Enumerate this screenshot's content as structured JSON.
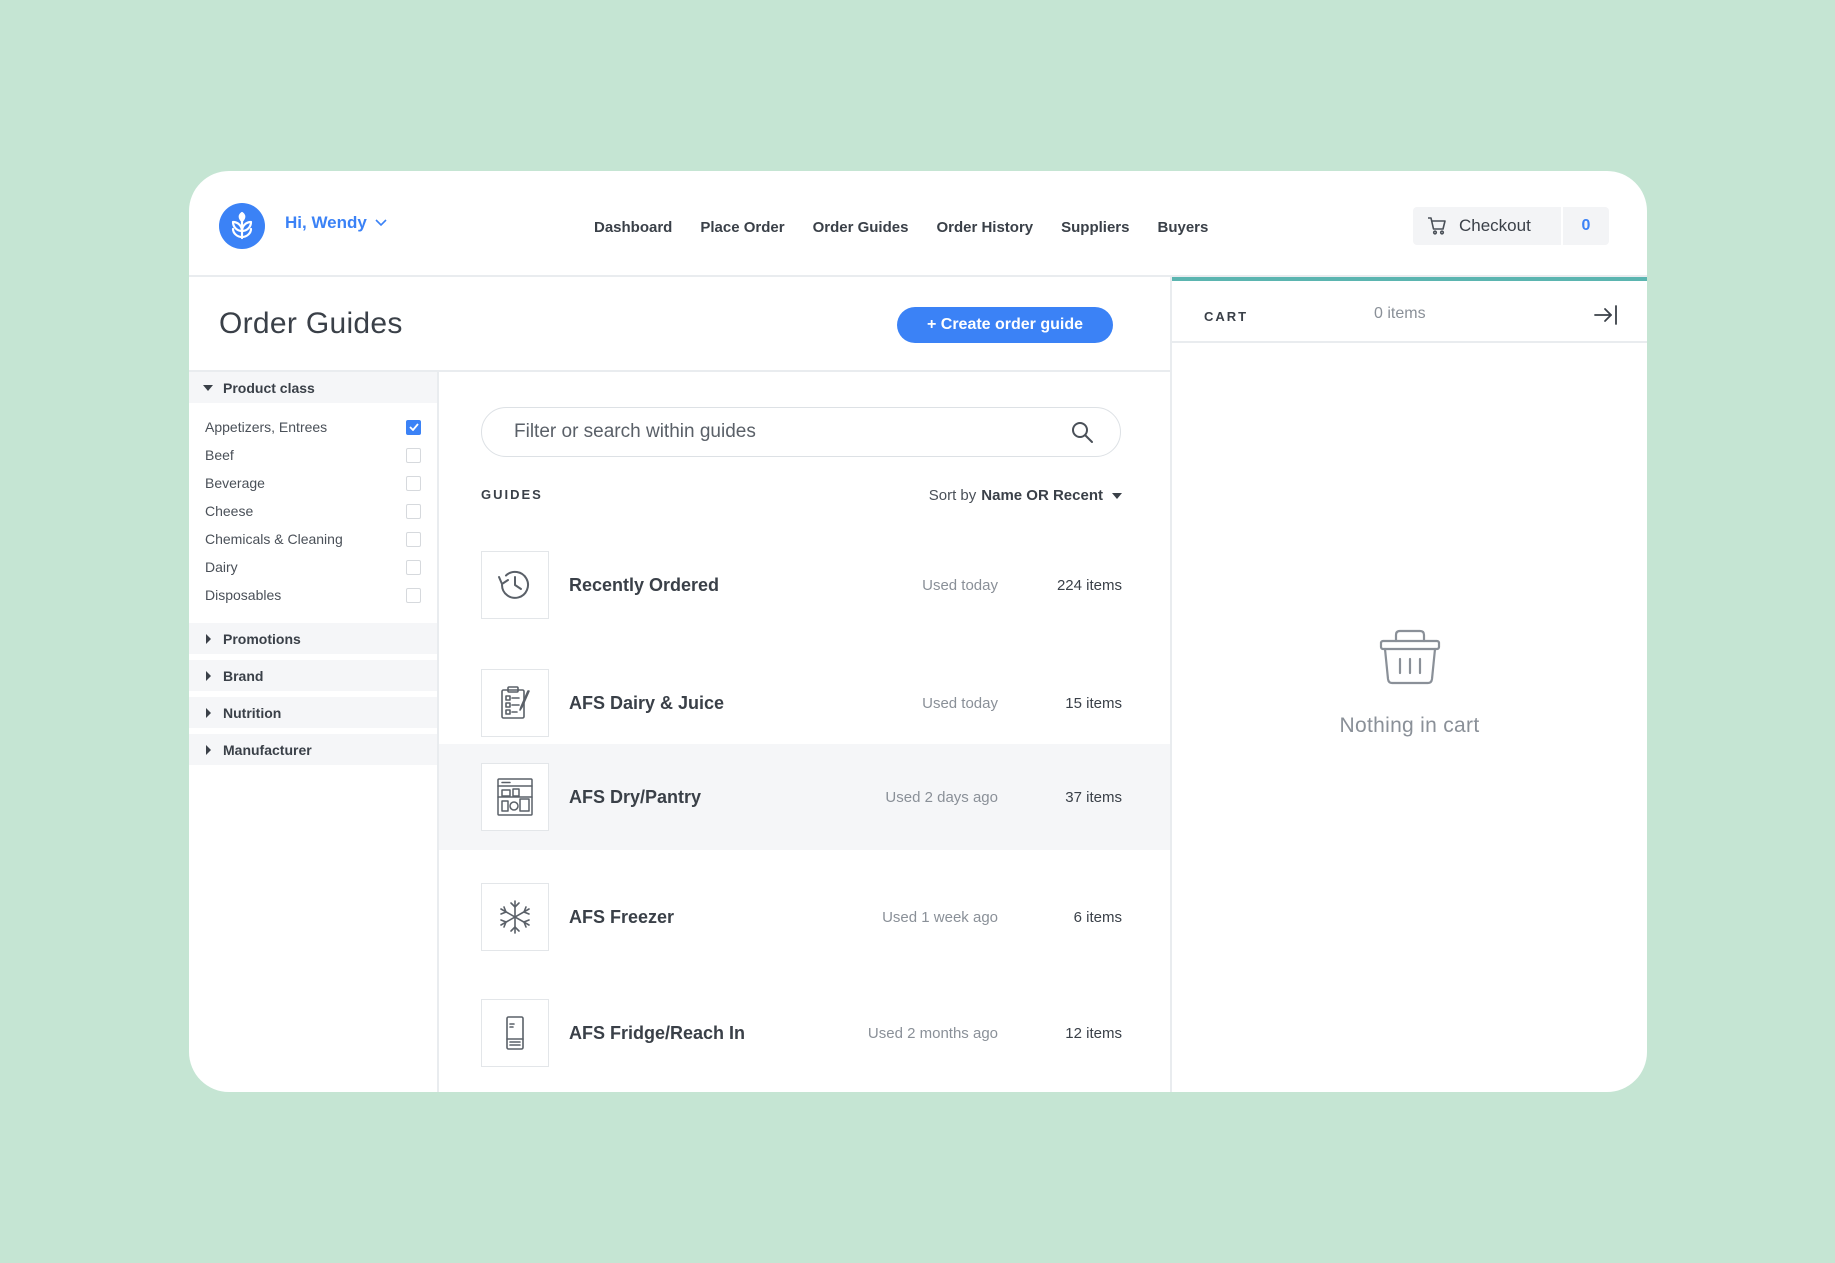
{
  "header": {
    "greeting": "Hi, Wendy",
    "nav": [
      "Dashboard",
      "Place Order",
      "Order Guides",
      "Order History",
      "Suppliers",
      "Buyers"
    ],
    "checkout_label": "Checkout",
    "checkout_count": "0"
  },
  "page": {
    "title": "Order Guides",
    "create_button": "+ Create order guide"
  },
  "sidebar": {
    "product_class": {
      "label": "Product class",
      "items": [
        {
          "label": "Appetizers, Entrees",
          "checked": true
        },
        {
          "label": "Beef",
          "checked": false
        },
        {
          "label": "Beverage",
          "checked": false
        },
        {
          "label": "Cheese",
          "checked": false
        },
        {
          "label": "Chemicals & Cleaning",
          "checked": false
        },
        {
          "label": "Dairy",
          "checked": false
        },
        {
          "label": "Disposables",
          "checked": false
        }
      ]
    },
    "collapsed": [
      "Promotions",
      "Brand",
      "Nutrition",
      "Manufacturer"
    ]
  },
  "search": {
    "placeholder": "Filter or search within guides"
  },
  "guides": {
    "label": "GUIDES",
    "sort_prefix": "Sort by",
    "sort_value": "Name OR Recent",
    "rows": [
      {
        "name": "Recently Ordered",
        "used": "Used today",
        "count": "224 items",
        "icon": "history-icon"
      },
      {
        "name": "AFS Dairy & Juice",
        "used": "Used today",
        "count": "15 items",
        "icon": "clipboard-checklist-icon"
      },
      {
        "name": "AFS Dry/Pantry",
        "used": "Used 2 days ago",
        "count": "37 items",
        "icon": "pantry-shelf-icon"
      },
      {
        "name": "AFS Freezer",
        "used": "Used 1 week ago",
        "count": "6 items",
        "icon": "snowflake-icon"
      },
      {
        "name": "AFS Fridge/Reach In",
        "used": "Used 2 months ago",
        "count": "12 items",
        "icon": "fridge-icon"
      }
    ]
  },
  "cart": {
    "label": "CART",
    "items": "0 items",
    "empty_text": "Nothing in cart"
  },
  "colors": {
    "accent": "#3b82f6",
    "cart_accent": "#5bb5b0",
    "background": "#c5e5d3"
  }
}
